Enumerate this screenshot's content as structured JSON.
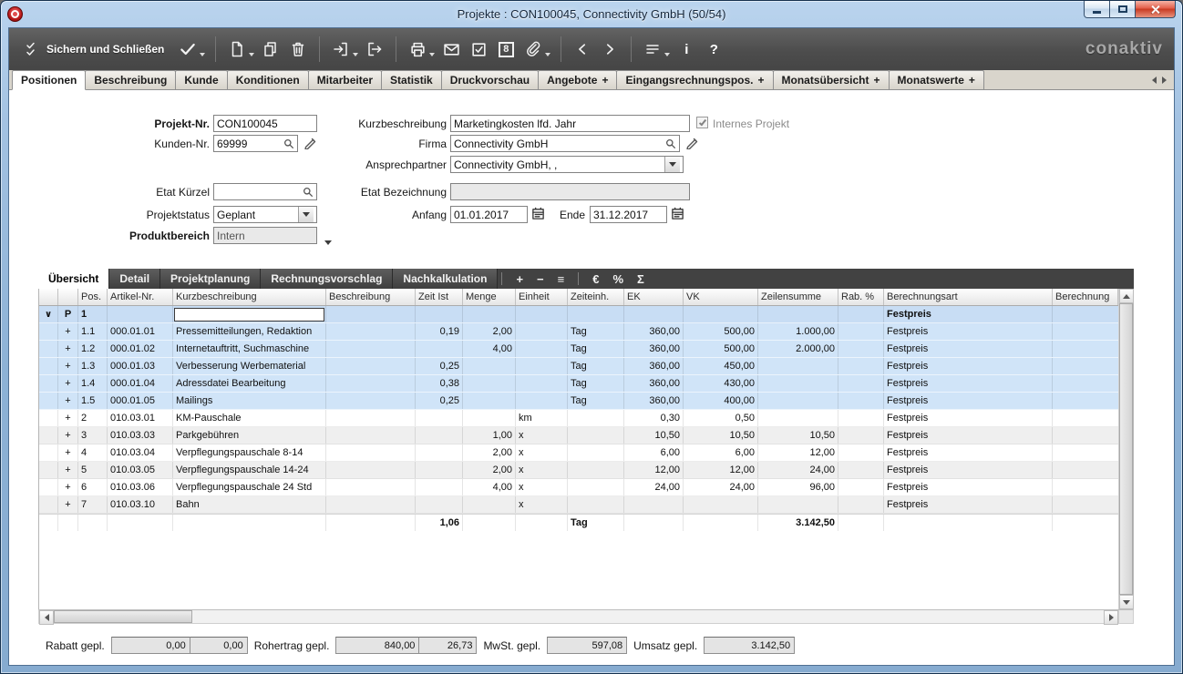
{
  "window": {
    "title": "Projekte : CON100045, Connectivity GmbH (50/54)"
  },
  "toolbar": {
    "save_close": "Sichern und Schließen",
    "eight": "8",
    "info": "i",
    "help": "?",
    "logo": "conaktiv"
  },
  "tabbar": {
    "plus_glyph": "+",
    "tabs": [
      {
        "label": "Positionen",
        "active": true,
        "plus": false
      },
      {
        "label": "Beschreibung",
        "active": false,
        "plus": false
      },
      {
        "label": "Kunde",
        "active": false,
        "plus": false
      },
      {
        "label": "Konditionen",
        "active": false,
        "plus": false
      },
      {
        "label": "Mitarbeiter",
        "active": false,
        "plus": false
      },
      {
        "label": "Statistik",
        "active": false,
        "plus": false
      },
      {
        "label": "Druckvorschau",
        "active": false,
        "plus": false
      },
      {
        "label": "Angebote",
        "active": false,
        "plus": true
      },
      {
        "label": "Eingangsrechnungspos.",
        "active": false,
        "plus": true
      },
      {
        "label": "Monatsübersicht",
        "active": false,
        "plus": true
      },
      {
        "label": "Monatswerte",
        "active": false,
        "plus": true
      }
    ]
  },
  "form": {
    "labels": {
      "projekt_nr": "Projekt-Nr.",
      "kunden_nr": "Kunden-Nr.",
      "kurzbeschreibung": "Kurzbeschreibung",
      "firma": "Firma",
      "ansprechpartner": "Ansprechpartner",
      "internes_projekt": "Internes Projekt",
      "etat_kuerzel": "Etat Kürzel",
      "etat_bezeichnung": "Etat Bezeichnung",
      "projektstatus": "Projektstatus",
      "anfang": "Anfang",
      "ende": "Ende",
      "produktbereich": "Produktbereich"
    },
    "values": {
      "projekt_nr": "CON100045",
      "kunden_nr": "69999",
      "kurzbeschreibung": "Marketingkosten lfd. Jahr",
      "firma": "Connectivity GmbH",
      "ansprechpartner": "Connectivity GmbH, ,",
      "etat_kuerzel": "",
      "etat_bezeichnung": "",
      "projektstatus": "Geplant",
      "anfang": "01.01.2017",
      "ende": "31.12.2017",
      "produktbereich": "Intern"
    },
    "internes_projekt_checked": true
  },
  "subtabs": {
    "tabs": [
      {
        "label": "Übersicht",
        "active": true
      },
      {
        "label": "Detail",
        "active": false
      },
      {
        "label": "Projektplanung",
        "active": false
      },
      {
        "label": "Rechnungsvorschlag",
        "active": false
      },
      {
        "label": "Nachkalkulation",
        "active": false
      }
    ],
    "icons": [
      {
        "name": "separator",
        "glyph": ""
      },
      {
        "name": "add-position",
        "glyph": "+"
      },
      {
        "name": "remove-position",
        "glyph": "−"
      },
      {
        "name": "list-view",
        "glyph": "≡"
      },
      {
        "name": "separator",
        "glyph": ""
      },
      {
        "name": "euro",
        "glyph": "€"
      },
      {
        "name": "percent",
        "glyph": "%"
      },
      {
        "name": "sum",
        "glyph": "Σ"
      }
    ]
  },
  "table": {
    "headers": [
      "",
      "",
      "Pos.",
      "Artikel-Nr.",
      "Kurzbeschreibung",
      "Beschreibung",
      "Zeit Ist",
      "Menge",
      "Einheit",
      "Zeiteinh.",
      "EK",
      "VK",
      "Zeilensumme",
      "Rab. %",
      "Berechnungsart",
      "Berechnung"
    ],
    "rows": [
      {
        "type": "group",
        "c0": "∨",
        "c1": "P",
        "pos": "1",
        "artikel": "",
        "kurz": "",
        "beschreibung": "",
        "zeit_ist": "",
        "menge": "",
        "einheit": "",
        "zeiteinh": "",
        "ek": "",
        "vk": "",
        "zeilensumme": "",
        "rab": "",
        "art": "Festpreis",
        "extra": ""
      },
      {
        "type": "sub",
        "c0": "",
        "c1": "+",
        "pos": "1.1",
        "artikel": "000.01.01",
        "kurz": "Pressemitteilungen, Redaktion",
        "beschreibung": "",
        "zeit_ist": "0,19",
        "menge": "2,00",
        "einheit": "",
        "zeiteinh": "Tag",
        "ek": "360,00",
        "vk": "500,00",
        "zeilensumme": "1.000,00",
        "rab": "",
        "art": "Festpreis",
        "extra": ""
      },
      {
        "type": "sub",
        "c0": "",
        "c1": "+",
        "pos": "1.2",
        "artikel": "000.01.02",
        "kurz": "Internetauftritt, Suchmaschine",
        "beschreibung": "",
        "zeit_ist": "",
        "menge": "4,00",
        "einheit": "",
        "zeiteinh": "Tag",
        "ek": "360,00",
        "vk": "500,00",
        "zeilensumme": "2.000,00",
        "rab": "",
        "art": "Festpreis",
        "extra": ""
      },
      {
        "type": "sub",
        "c0": "",
        "c1": "+",
        "pos": "1.3",
        "artikel": "000.01.03",
        "kurz": "Verbesserung Werbematerial",
        "beschreibung": "",
        "zeit_ist": "0,25",
        "menge": "",
        "einheit": "",
        "zeiteinh": "Tag",
        "ek": "360,00",
        "vk": "450,00",
        "zeilensumme": "",
        "rab": "",
        "art": "Festpreis",
        "extra": ""
      },
      {
        "type": "sub",
        "c0": "",
        "c1": "+",
        "pos": "1.4",
        "artikel": "000.01.04",
        "kurz": "Adressdatei Bearbeitung",
        "beschreibung": "",
        "zeit_ist": "0,38",
        "menge": "",
        "einheit": "",
        "zeiteinh": "Tag",
        "ek": "360,00",
        "vk": "430,00",
        "zeilensumme": "",
        "rab": "",
        "art": "Festpreis",
        "extra": ""
      },
      {
        "type": "sub",
        "c0": "",
        "c1": "+",
        "pos": "1.5",
        "artikel": "000.01.05",
        "kurz": "Mailings",
        "beschreibung": "",
        "zeit_ist": "0,25",
        "menge": "",
        "einheit": "",
        "zeiteinh": "Tag",
        "ek": "360,00",
        "vk": "400,00",
        "zeilensumme": "",
        "rab": "",
        "art": "Festpreis",
        "extra": ""
      },
      {
        "type": "alt0",
        "c0": "",
        "c1": "+",
        "pos": "2",
        "artikel": "010.03.01",
        "kurz": "KM-Pauschale",
        "beschreibung": "",
        "zeit_ist": "",
        "menge": "",
        "einheit": "km",
        "zeiteinh": "",
        "ek": "0,30",
        "vk": "0,50",
        "zeilensumme": "",
        "rab": "",
        "art": "Festpreis",
        "extra": ""
      },
      {
        "type": "alt1",
        "c0": "",
        "c1": "+",
        "pos": "3",
        "artikel": "010.03.03",
        "kurz": "Parkgebühren",
        "beschreibung": "",
        "zeit_ist": "",
        "menge": "1,00",
        "einheit": "x",
        "zeiteinh": "",
        "ek": "10,50",
        "vk": "10,50",
        "zeilensumme": "10,50",
        "rab": "",
        "art": "Festpreis",
        "extra": ""
      },
      {
        "type": "alt0",
        "c0": "",
        "c1": "+",
        "pos": "4",
        "artikel": "010.03.04",
        "kurz": "Verpflegungspauschale 8-14",
        "beschreibung": "",
        "zeit_ist": "",
        "menge": "2,00",
        "einheit": "x",
        "zeiteinh": "",
        "ek": "6,00",
        "vk": "6,00",
        "zeilensumme": "12,00",
        "rab": "",
        "art": "Festpreis",
        "extra": ""
      },
      {
        "type": "alt1",
        "c0": "",
        "c1": "+",
        "pos": "5",
        "artikel": "010.03.05",
        "kurz": "Verpflegungspauschale 14-24",
        "beschreibung": "",
        "zeit_ist": "",
        "menge": "2,00",
        "einheit": "x",
        "zeiteinh": "",
        "ek": "12,00",
        "vk": "12,00",
        "zeilensumme": "24,00",
        "rab": "",
        "art": "Festpreis",
        "extra": ""
      },
      {
        "type": "alt0",
        "c0": "",
        "c1": "+",
        "pos": "6",
        "artikel": "010.03.06",
        "kurz": "Verpflegungspauschale 24 Std",
        "beschreibung": "",
        "zeit_ist": "",
        "menge": "4,00",
        "einheit": "x",
        "zeiteinh": "",
        "ek": "24,00",
        "vk": "24,00",
        "zeilensumme": "96,00",
        "rab": "",
        "art": "Festpreis",
        "extra": ""
      },
      {
        "type": "alt1",
        "c0": "",
        "c1": "+",
        "pos": "7",
        "artikel": "010.03.10",
        "kurz": "Bahn",
        "beschreibung": "",
        "zeit_ist": "",
        "menge": "",
        "einheit": "x",
        "zeiteinh": "",
        "ek": "",
        "vk": "",
        "zeilensumme": "",
        "rab": "",
        "art": "Festpreis",
        "extra": ""
      },
      {
        "type": "sum",
        "c0": "",
        "c1": "",
        "pos": "",
        "artikel": "",
        "kurz": "",
        "beschreibung": "",
        "zeit_ist": "1,06",
        "menge": "",
        "einheit": "",
        "zeiteinh": "Tag",
        "ek": "",
        "vk": "",
        "zeilensumme": "3.142,50",
        "rab": "",
        "art": "",
        "extra": ""
      }
    ]
  },
  "footer": {
    "rabatt_label": "Rabatt gepl.",
    "rabatt_value1": "0,00",
    "rabatt_value2": "0,00",
    "rohertrag_label": "Rohertrag gepl.",
    "rohertrag_value1": "840,00",
    "rohertrag_value2": "26,73",
    "mwst_label": "MwSt. gepl.",
    "mwst_value": "597,08",
    "umsatz_label": "Umsatz gepl.",
    "umsatz_value": "3.142,50"
  }
}
